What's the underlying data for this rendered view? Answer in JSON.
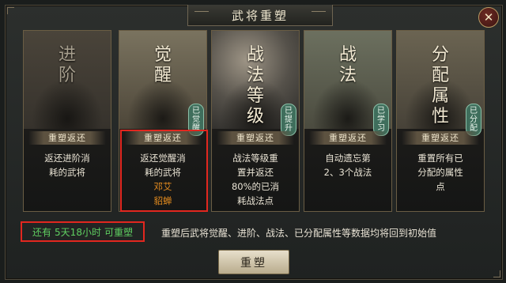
{
  "title": "武将重塑",
  "close_icon": "close-icon",
  "cards": [
    {
      "title_chars": [
        "进",
        "阶"
      ],
      "badge": [],
      "reset_label": "重塑返还",
      "desc_lines": [
        "返还进阶消",
        "耗的武将"
      ],
      "names": [],
      "dim": true
    },
    {
      "title_chars": [
        "觉",
        "醒"
      ],
      "badge": [
        "已",
        "觉",
        "醒"
      ],
      "reset_label": "重塑返还",
      "desc_lines": [
        "返还觉醒消",
        "耗的武将"
      ],
      "names": [
        "邓艾",
        "貂蝉"
      ],
      "dim": false
    },
    {
      "title_chars": [
        "战",
        "法",
        "等",
        "级"
      ],
      "badge": [
        "已",
        "提",
        "升"
      ],
      "reset_label": "重塑返还",
      "desc_lines": [
        "战法等级重",
        "置并返还",
        "80%的已消",
        "耗战法点"
      ],
      "names": [],
      "dim": false
    },
    {
      "title_chars": [
        "战",
        "法"
      ],
      "badge": [
        "已",
        "学",
        "习"
      ],
      "reset_label": "重塑返还",
      "desc_lines": [
        "自动遗忘第",
        "2、3个战法"
      ],
      "names": [],
      "dim": false
    },
    {
      "title_chars": [
        "分",
        "配",
        "属",
        "性"
      ],
      "badge": [
        "已",
        "分",
        "配"
      ],
      "reset_label": "重塑返还",
      "desc_lines": [
        "重置所有已",
        "分配的属性",
        "点"
      ],
      "names": [],
      "dim": false
    }
  ],
  "status": {
    "prefix": "还有",
    "time": "5天18小时",
    "suffix": "可重塑"
  },
  "note": "重塑后武将觉醒、进阶、战法、已分配属性等数据均将回到初始值",
  "button_label": "重塑"
}
